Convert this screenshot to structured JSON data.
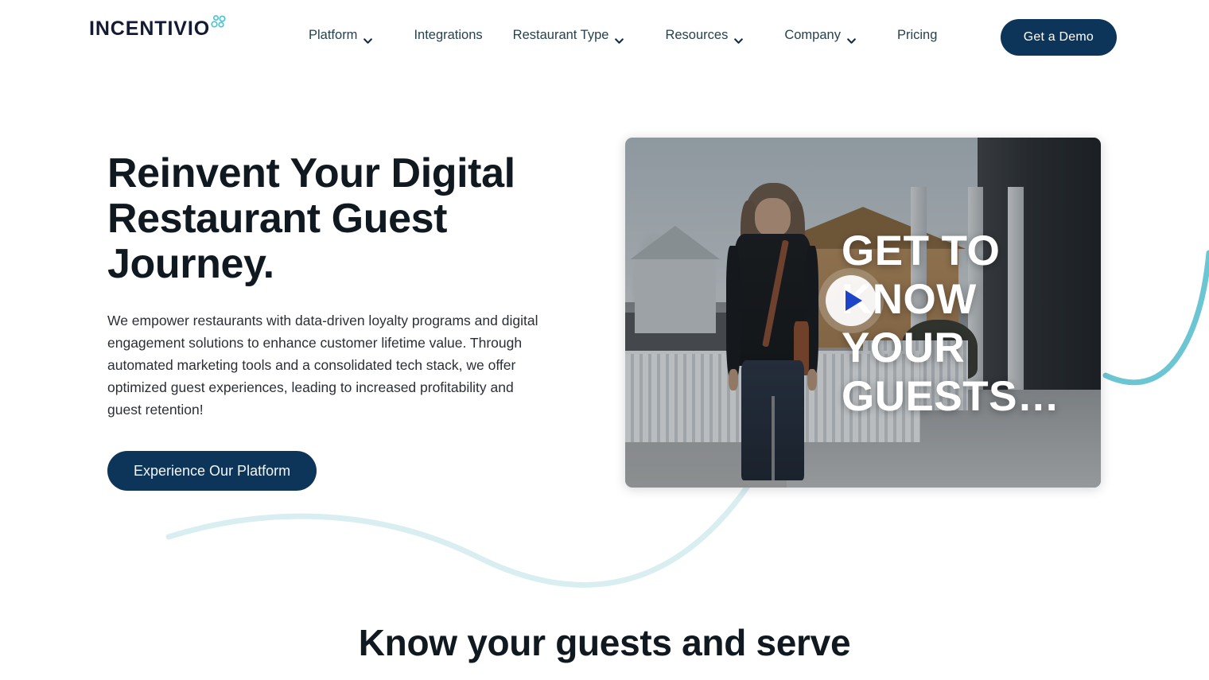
{
  "header": {
    "logo": {
      "text": "INCENTIVIO",
      "icon": "bubbles-icon",
      "word_color": "#141a33",
      "bubble_color": "#4fc3cf"
    },
    "nav": [
      {
        "label": "Platform",
        "has_dropdown": true,
        "icon": "chevron-down-icon"
      },
      {
        "label": "Integrations",
        "has_dropdown": false,
        "icon": ""
      },
      {
        "label": "Restaurant Type",
        "has_dropdown": true,
        "icon": "chevron-down-icon"
      },
      {
        "label": "Resources",
        "has_dropdown": true,
        "icon": "chevron-down-icon"
      },
      {
        "label": "Company",
        "has_dropdown": true,
        "icon": "chevron-down-icon"
      },
      {
        "label": "Pricing",
        "has_dropdown": false,
        "icon": ""
      }
    ],
    "cta": {
      "label": "Get a Demo",
      "bg_color": "#0d3559",
      "text_color": "#ffffff"
    }
  },
  "hero": {
    "title": "Reinvent Your Digital Restaurant Guest Journey.",
    "paragraph": "We empower restaurants with data-driven loyalty programs and digital engagement solutions to enhance customer lifetime value. Through automated marketing tools and a consolidated tech stack, we offer optimized guest experiences, leading to increased profitability and guest retention!",
    "cta": {
      "label": "Experience Our Platform",
      "bg_color": "#0d3559",
      "text_color": "#f2f6f9"
    },
    "title_color": "#101820",
    "paragraph_color": "#2b2f36"
  },
  "video": {
    "overlay_text": "GET TO KNOW YOUR GUESTS…",
    "play_icon": "play-triangle-icon",
    "play_triangle_color": "#1b44c8",
    "play_circle_color": "#ffffff",
    "scene_description": "Woman walking along white picket fence beside houses"
  },
  "decor": {
    "wave_color": "#9fd9e0",
    "wave_color_light": "#d7eef1"
  },
  "next_section": {
    "heading": "Know your guests and serve"
  }
}
